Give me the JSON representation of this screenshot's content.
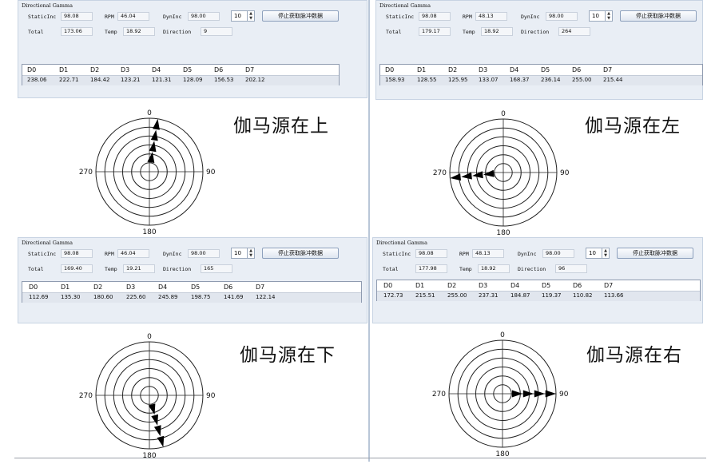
{
  "panels": [
    {
      "title": "Directional Gamma",
      "static_label": "StaticInc",
      "static_value": "98.08",
      "rpm_label": "RPM",
      "rpm_value": "46.04",
      "dyn_label": "DynInc",
      "dyn_value": "98.00",
      "spin_value": "10",
      "button_label": "停止获取脉冲数据",
      "total_label": "Total",
      "total_value": "173.06",
      "temp_label": "Temp",
      "temp_value": "18.92",
      "direction_label": "Direction",
      "direction_value": "9",
      "headers": [
        "D0",
        "D1",
        "D2",
        "D3",
        "D4",
        "D5",
        "D6",
        "D7"
      ],
      "values": [
        "238.06",
        "222.71",
        "184.42",
        "123.21",
        "121.31",
        "128.09",
        "156.53",
        "202.12"
      ],
      "caption": "伽马源在上",
      "polar_labels": {
        "top": "0",
        "right": "90",
        "bottom": "180",
        "left": "270"
      },
      "arrow_direction_deg": 9,
      "arrow_count": 4
    },
    {
      "title": "Directional Gamma",
      "static_label": "StaticInc",
      "static_value": "98.08",
      "rpm_label": "RPM",
      "rpm_value": "48.13",
      "dyn_label": "DynInc",
      "dyn_value": "98.00",
      "spin_value": "10",
      "button_label": "停止获取脉冲数据",
      "total_label": "Total",
      "total_value": "179.17",
      "temp_label": "Temp",
      "temp_value": "18.92",
      "direction_label": "Direction",
      "direction_value": "264",
      "headers": [
        "D0",
        "D1",
        "D2",
        "D3",
        "D4",
        "D5",
        "D6",
        "D7"
      ],
      "values": [
        "158.93",
        "128.55",
        "125.95",
        "133.07",
        "168.37",
        "236.14",
        "255.00",
        "215.44"
      ],
      "caption": "伽马源在左",
      "polar_labels": {
        "top": "0",
        "right": "90",
        "bottom": "180",
        "left": "270"
      },
      "arrow_direction_deg": 264,
      "arrow_count": 4
    },
    {
      "title": "Directional Gamma",
      "static_label": "StaticInc",
      "static_value": "98.08",
      "rpm_label": "RPM",
      "rpm_value": "46.04",
      "dyn_label": "DynInc",
      "dyn_value": "98.00",
      "spin_value": "10",
      "button_label": "停止获取脉冲数据",
      "total_label": "Total",
      "total_value": "169.40",
      "temp_label": "Temp",
      "temp_value": "19.21",
      "direction_label": "Direction",
      "direction_value": "165",
      "headers": [
        "D0",
        "D1",
        "D2",
        "D3",
        "D4",
        "D5",
        "D6",
        "D7"
      ],
      "values": [
        "112.69",
        "135.30",
        "180.60",
        "225.60",
        "245.89",
        "198.75",
        "141.69",
        "122.14"
      ],
      "caption": "伽马源在下",
      "polar_labels": {
        "top": "0",
        "right": "90",
        "bottom": "180",
        "left": "270"
      },
      "arrow_direction_deg": 165,
      "arrow_count": 4
    },
    {
      "title": "Directional Gamma",
      "static_label": "StaticInc",
      "static_value": "98.08",
      "rpm_label": "RPM",
      "rpm_value": "48.13",
      "dyn_label": "DynInc",
      "dyn_value": "98.00",
      "spin_value": "10",
      "button_label": "停止获取脉冲数据",
      "total_label": "Total",
      "total_value": "177.98",
      "temp_label": "Temp",
      "temp_value": "18.92",
      "direction_label": "Direction",
      "direction_value": "96",
      "headers": [
        "D0",
        "D1",
        "D2",
        "D3",
        "D4",
        "D5",
        "D6",
        "D7"
      ],
      "values": [
        "172.73",
        "215.51",
        "255.00",
        "237.31",
        "184.87",
        "119.37",
        "110.82",
        "113.66"
      ],
      "caption": "伽马源在右",
      "polar_labels": {
        "top": "0",
        "right": "90",
        "bottom": "180",
        "left": "270"
      },
      "arrow_direction_deg": 90,
      "arrow_count": 4
    }
  ],
  "colors": {
    "panel_bg": "#e9eef5",
    "ring": "#222222",
    "arrow": "#000000"
  }
}
